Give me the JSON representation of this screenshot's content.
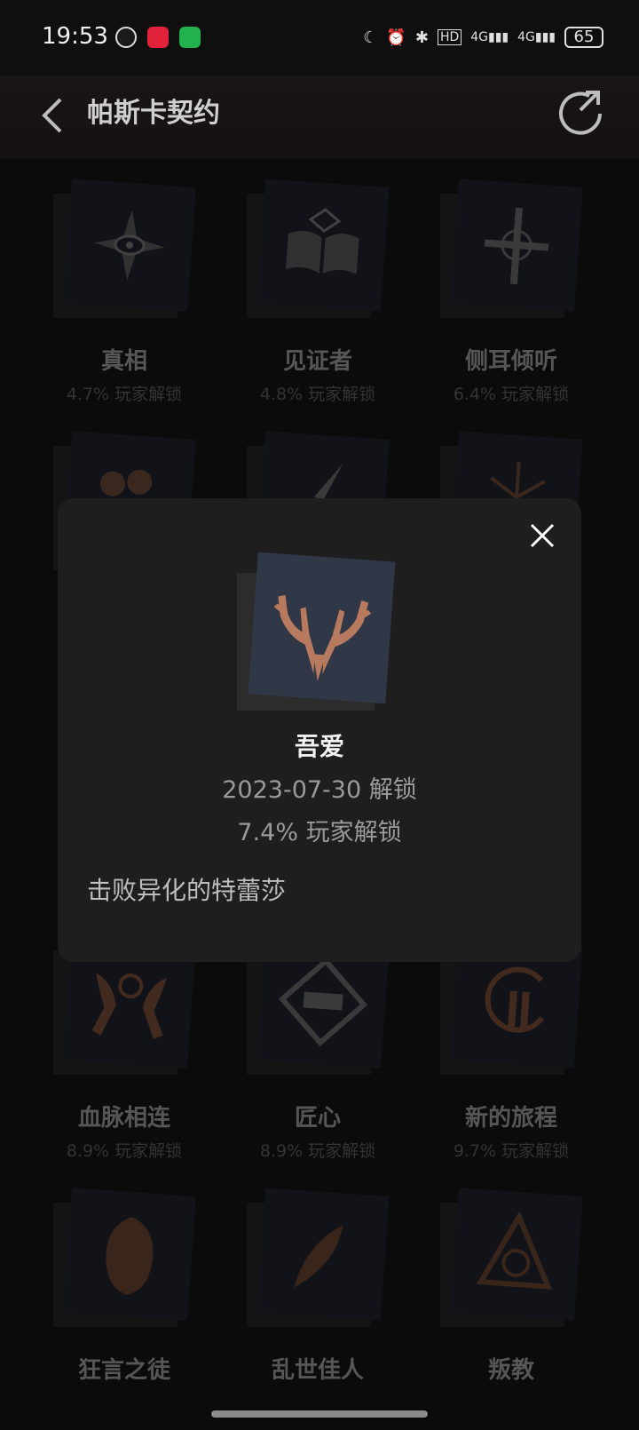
{
  "status_bar": {
    "time": "19:53",
    "battery": "65",
    "app_icons": [
      "wechat-icon",
      "taobao-icon",
      "message-icon"
    ],
    "app_icon_colors": [
      "#111111",
      "#e0233b",
      "#22b14c"
    ],
    "sys_icons": [
      "moon-icon",
      "alarm-icon",
      "bluetooth-icon",
      "hd-icon",
      "signal-4g-icon",
      "signal-4g-icon"
    ]
  },
  "header": {
    "title": "帕斯卡契约"
  },
  "achievements": [
    {
      "name": "真相",
      "pct": "4.7% 玩家解锁",
      "icon": "eye-star-icon"
    },
    {
      "name": "见证者",
      "pct": "4.8% 玩家解锁",
      "icon": "open-book-icon"
    },
    {
      "name": "侧耳倾听",
      "pct": "6.4% 玩家解锁",
      "icon": "cross-icon"
    },
    {
      "name": "",
      "pct": "",
      "icon": "cluster-icon"
    },
    {
      "name": "",
      "pct": "",
      "icon": "blade-icon"
    },
    {
      "name": "",
      "pct": "",
      "icon": "sunburst-icon"
    },
    {
      "name": "血脉相连",
      "pct": "8.9% 玩家解锁",
      "icon": "twin-hands-icon"
    },
    {
      "name": "匠心",
      "pct": "8.9% 玩家解锁",
      "icon": "anvil-diamond-icon"
    },
    {
      "name": "新的旅程",
      "pct": "9.7% 玩家解锁",
      "icon": "gate-ring-icon"
    },
    {
      "name": "狂言之徒",
      "pct": "",
      "icon": "hooded-figure-icon"
    },
    {
      "name": "乱世佳人",
      "pct": "",
      "icon": "feather-icon"
    },
    {
      "name": "叛教",
      "pct": "",
      "icon": "triangle-sigil-icon"
    }
  ],
  "modal": {
    "name": "吾爱",
    "date": "2023-07-30 解锁",
    "pct": "7.4% 玩家解锁",
    "description": "击败异化的特蕾莎",
    "icon": "antler-icon",
    "accent": "#b87a5e"
  }
}
